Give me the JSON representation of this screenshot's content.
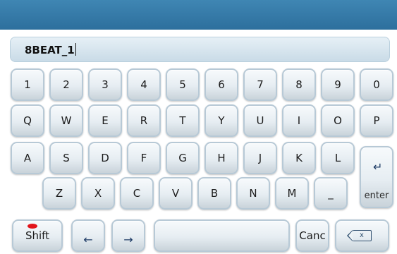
{
  "input": {
    "value": "8BEAT_1"
  },
  "rows": {
    "r1": [
      "1",
      "2",
      "3",
      "4",
      "5",
      "6",
      "7",
      "8",
      "9",
      "0"
    ],
    "r2": [
      "Q",
      "W",
      "E",
      "R",
      "T",
      "Y",
      "U",
      "I",
      "O",
      "P"
    ],
    "r3": [
      "A",
      "S",
      "D",
      "F",
      "G",
      "H",
      "J",
      "K",
      "L"
    ],
    "r4": [
      "Z",
      "X",
      "C",
      "V",
      "B",
      "N",
      "M",
      "_"
    ]
  },
  "special": {
    "enter": "enter",
    "shift": "Shift",
    "cancel": "Canc",
    "backspace_glyph": "x"
  },
  "icons": {
    "enter": "return-arrow-icon",
    "left": "left-arrow-icon",
    "right": "right-arrow-icon",
    "backspace": "backspace-icon"
  },
  "colors": {
    "titlebar": "#3a80ad",
    "shift_indicator": "#e2141b"
  }
}
